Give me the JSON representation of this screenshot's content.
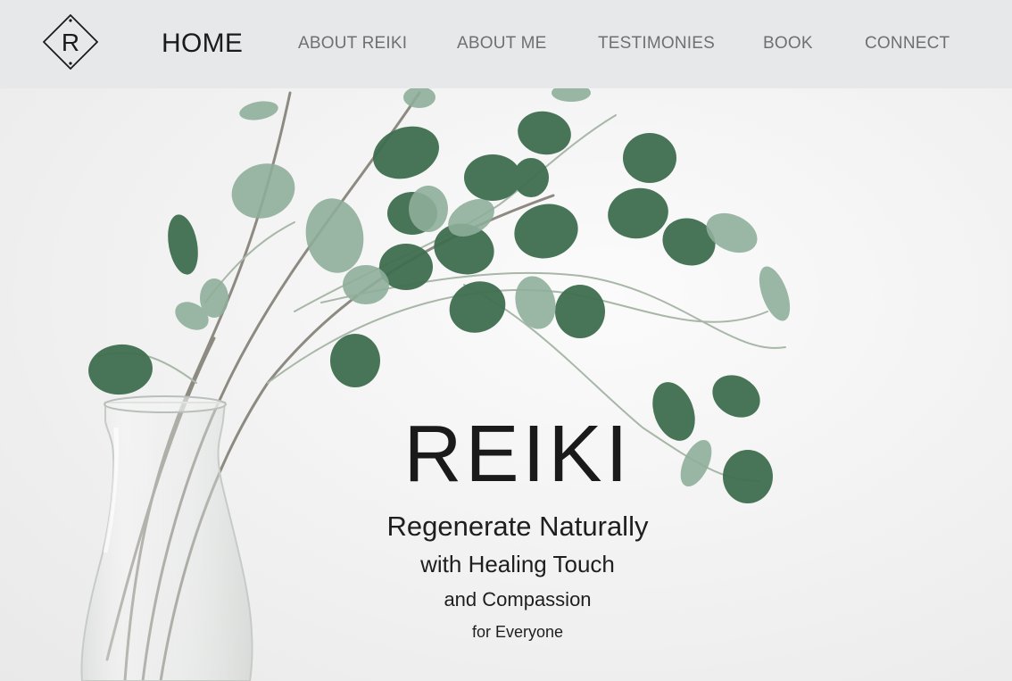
{
  "nav": {
    "logo_letter": "R",
    "items": [
      {
        "label": "HOME",
        "active": true
      },
      {
        "label": "ABOUT REIKI",
        "active": false
      },
      {
        "label": "ABOUT ME",
        "active": false
      },
      {
        "label": "TESTIMONIES",
        "active": false
      },
      {
        "label": "BOOK",
        "active": false
      },
      {
        "label": "CONNECT",
        "active": false
      }
    ]
  },
  "hero": {
    "title": "REIKI",
    "lines": [
      "Regenerate Naturally",
      "with Healing Touch",
      "and Compassion",
      "for Everyone"
    ],
    "image_subject": "eucalyptus-branches-in-glass-vase"
  },
  "colors": {
    "header_bg": "#e7e8ea",
    "nav_text": "#707070",
    "nav_active": "#1b1b1b",
    "leaf_dark": "#3f6e4f",
    "leaf_light": "#8fae9a"
  }
}
